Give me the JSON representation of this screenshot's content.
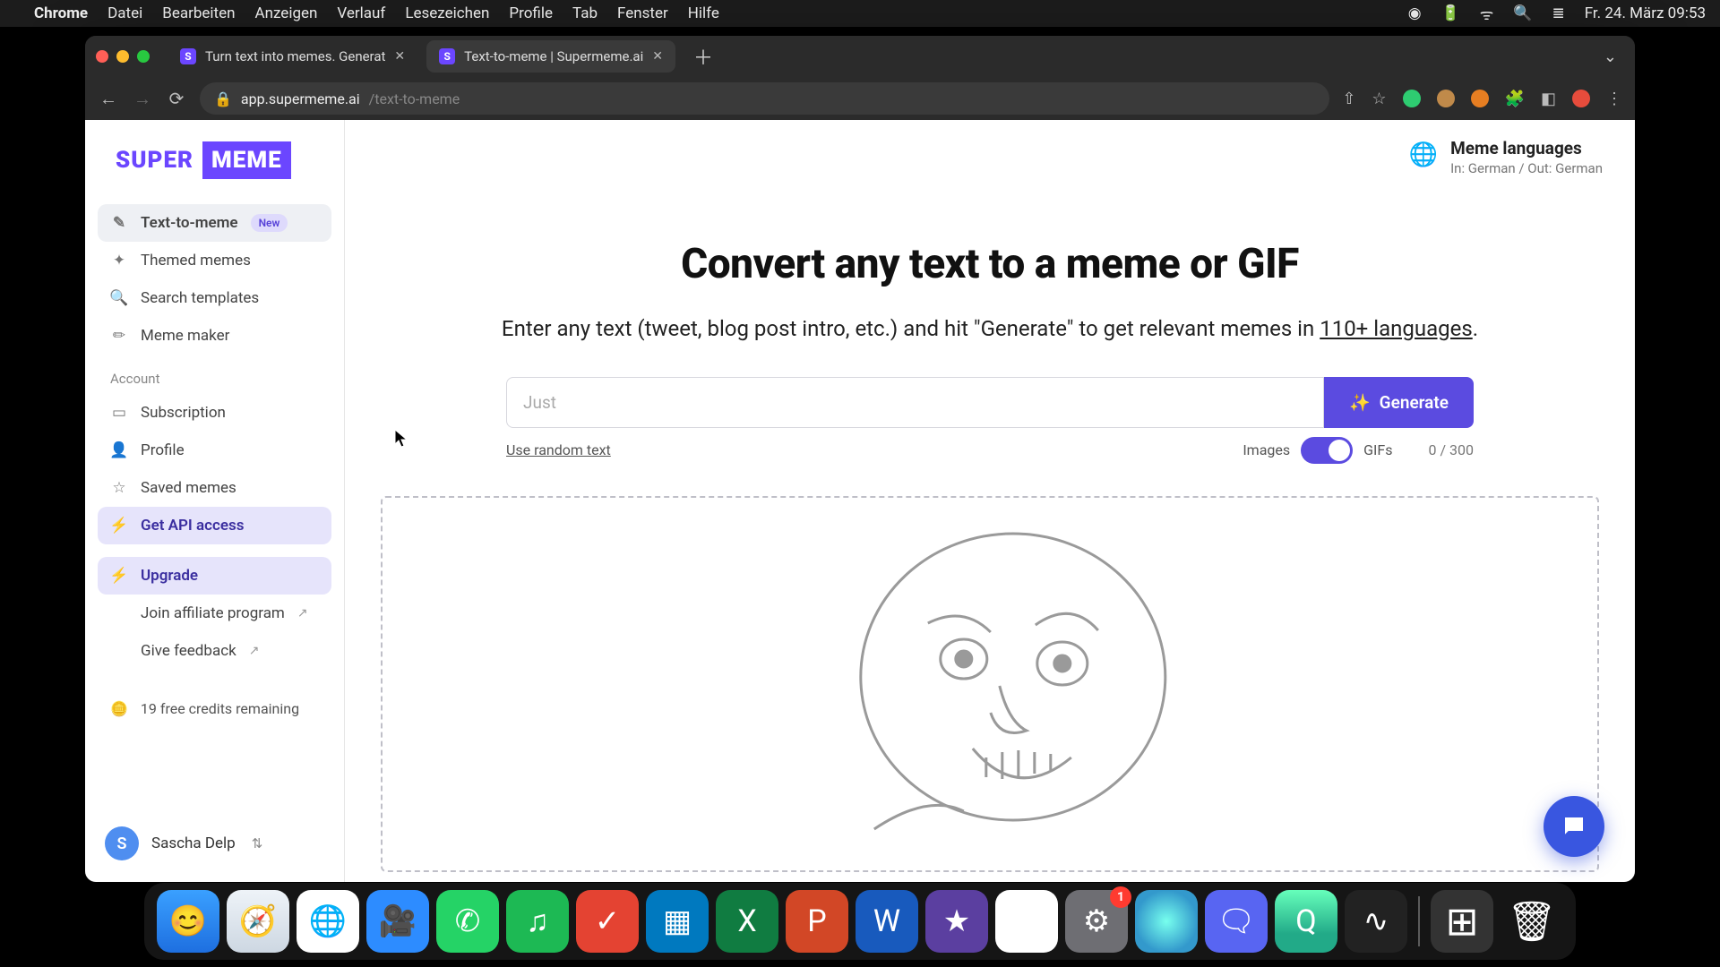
{
  "menubar": {
    "app": "Chrome",
    "items": [
      "Datei",
      "Bearbeiten",
      "Anzeigen",
      "Verlauf",
      "Lesezeichen",
      "Profile",
      "Tab",
      "Fenster",
      "Hilfe"
    ],
    "clock": "Fr. 24. März  09:53"
  },
  "tabs": [
    {
      "title": "Turn text into memes. Generat",
      "active": false
    },
    {
      "title": "Text-to-meme | Supermeme.ai",
      "active": true
    }
  ],
  "url": {
    "host": "app.supermeme.ai",
    "path": "/text-to-meme"
  },
  "logo": {
    "a": "SUPER",
    "b": "MEME"
  },
  "sidebar": {
    "nav": [
      {
        "label": "Text-to-meme",
        "icon": "wand",
        "badge": "New",
        "active": true
      },
      {
        "label": "Themed memes",
        "icon": "sparkle"
      },
      {
        "label": "Search templates",
        "icon": "search"
      },
      {
        "label": "Meme maker",
        "icon": "pencil"
      }
    ],
    "section": "Account",
    "account": [
      {
        "label": "Subscription",
        "icon": "card"
      },
      {
        "label": "Profile",
        "icon": "user"
      },
      {
        "label": "Saved memes",
        "icon": "star"
      },
      {
        "label": "Get API access",
        "icon": "bolt",
        "hl": true
      }
    ],
    "upgrade": {
      "label": "Upgrade",
      "icon": "bolt"
    },
    "extra": [
      {
        "label": "Join affiliate program",
        "ext": true
      },
      {
        "label": "Give feedback",
        "ext": true
      }
    ],
    "credits": "19 free credits remaining",
    "user": {
      "initial": "S",
      "name": "Sascha Delp"
    }
  },
  "lang": {
    "title": "Meme languages",
    "sub": "In: German / Out: German"
  },
  "hero": {
    "title": "Convert any text to a meme or GIF",
    "sub_a": "Enter any text (tweet, blog post intro, etc.) and hit \"Generate\" to get relevant memes in ",
    "sub_link": "110+ languages",
    "sub_b": "."
  },
  "input": {
    "placeholder": "Just",
    "generate": "Generate"
  },
  "controls": {
    "random": "Use random text",
    "left": "Images",
    "right": "GIFs",
    "counter": "0 / 300"
  },
  "dock": {
    "apps": [
      {
        "name": "finder",
        "bg": "linear-gradient(#3aa0ff,#1e6fe0)",
        "glyph": "😊"
      },
      {
        "name": "safari",
        "bg": "linear-gradient(#eef3f8,#cdd7e2)",
        "glyph": "🧭"
      },
      {
        "name": "chrome",
        "bg": "#fff",
        "glyph": "🌐"
      },
      {
        "name": "zoom",
        "bg": "#2d8cff",
        "glyph": "🎥"
      },
      {
        "name": "whatsapp",
        "bg": "#25d366",
        "glyph": "✆"
      },
      {
        "name": "spotify",
        "bg": "#1db954",
        "glyph": "♫"
      },
      {
        "name": "todoist",
        "bg": "#e44332",
        "glyph": "✓"
      },
      {
        "name": "trello",
        "bg": "#0079bf",
        "glyph": "▦"
      },
      {
        "name": "excel",
        "bg": "#107c41",
        "glyph": "X"
      },
      {
        "name": "powerpoint",
        "bg": "#d24726",
        "glyph": "P"
      },
      {
        "name": "word",
        "bg": "#185abd",
        "glyph": "W"
      },
      {
        "name": "imovie",
        "bg": "#5b3fa0",
        "glyph": "★"
      },
      {
        "name": "drive",
        "bg": "#fff",
        "glyph": "▲"
      },
      {
        "name": "settings",
        "bg": "#6e6e73",
        "glyph": "⚙",
        "badge": "1"
      },
      {
        "name": "siri",
        "bg": "radial-gradient(circle,#7fe,#39c 70%)",
        "glyph": ""
      },
      {
        "name": "discord",
        "bg": "#5865f2",
        "glyph": "🗨"
      },
      {
        "name": "quicktime",
        "bg": "linear-gradient(#6fb,#2a8 70%)",
        "glyph": "Q"
      },
      {
        "name": "voice",
        "bg": "#222",
        "glyph": "∿"
      }
    ],
    "tray": [
      {
        "name": "launchpad",
        "bg": "#333",
        "glyph": "⊞"
      },
      {
        "name": "trash",
        "bg": "transparent",
        "glyph": "🗑"
      }
    ]
  }
}
